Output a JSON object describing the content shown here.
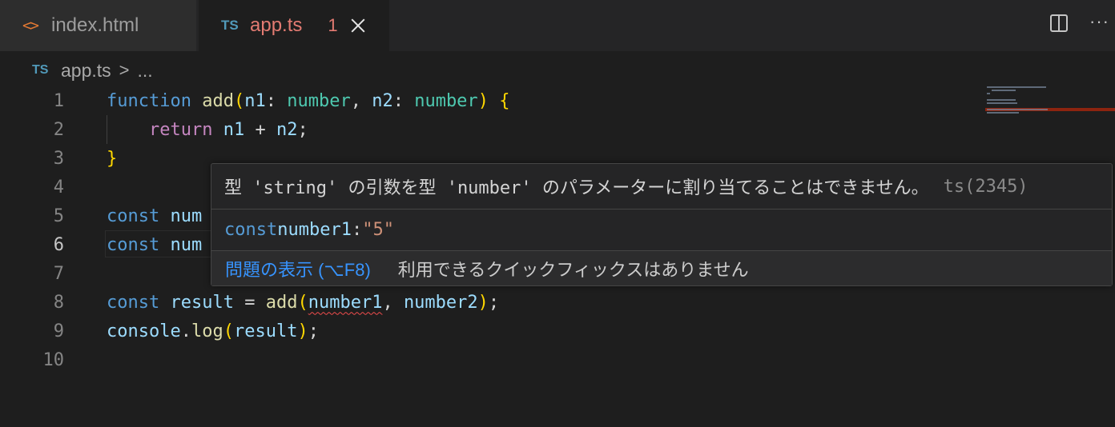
{
  "tabs": [
    {
      "icon": "html-icon",
      "label": "index.html"
    },
    {
      "icon": "ts-icon",
      "label": "app.ts",
      "problem_count": "1"
    }
  ],
  "icons": {
    "html_glyph": "<>",
    "ts_glyph": "TS",
    "more_glyph": "···"
  },
  "breadcrumb": {
    "file": "app.ts",
    "separator": ">",
    "rest": "..."
  },
  "editor": {
    "line_numbers": [
      "1",
      "2",
      "3",
      "4",
      "5",
      "6",
      "7",
      "8",
      "9",
      "10"
    ],
    "active_line": "6",
    "lines": {
      "l1": [
        {
          "t": "function",
          "c": "kw"
        },
        {
          "t": " ",
          "c": ""
        },
        {
          "t": "add",
          "c": "fn"
        },
        {
          "t": "(",
          "c": "br1"
        },
        {
          "t": "n1",
          "c": "var"
        },
        {
          "t": ": ",
          "c": ""
        },
        {
          "t": "number",
          "c": "typ"
        },
        {
          "t": ", ",
          "c": ""
        },
        {
          "t": "n2",
          "c": "var"
        },
        {
          "t": ": ",
          "c": ""
        },
        {
          "t": "number",
          "c": "typ"
        },
        {
          "t": ")",
          "c": "br1"
        },
        {
          "t": " ",
          "c": ""
        },
        {
          "t": "{",
          "c": "br1"
        }
      ],
      "l2": [
        {
          "t": "    ",
          "c": ""
        },
        {
          "t": "return",
          "c": "kw2"
        },
        {
          "t": " ",
          "c": ""
        },
        {
          "t": "n1",
          "c": "var"
        },
        {
          "t": " + ",
          "c": ""
        },
        {
          "t": "n2",
          "c": "var"
        },
        {
          "t": ";",
          "c": ""
        }
      ],
      "l3": [
        {
          "t": "}",
          "c": "br1"
        }
      ],
      "l5": [
        {
          "t": "const",
          "c": "kw"
        },
        {
          "t": " ",
          "c": ""
        },
        {
          "t": "num",
          "c": "var"
        }
      ],
      "l6": [
        {
          "t": "const",
          "c": "kw"
        },
        {
          "t": " ",
          "c": ""
        },
        {
          "t": "num",
          "c": "var"
        }
      ],
      "l8": [
        {
          "t": "const",
          "c": "kw"
        },
        {
          "t": " ",
          "c": ""
        },
        {
          "t": "result",
          "c": "var"
        },
        {
          "t": " = ",
          "c": ""
        },
        {
          "t": "add",
          "c": "fn"
        },
        {
          "t": "(",
          "c": "br1"
        },
        {
          "t": "number1",
          "c": "var sq"
        },
        {
          "t": ", ",
          "c": ""
        },
        {
          "t": "number2",
          "c": "var"
        },
        {
          "t": ")",
          "c": "br1"
        },
        {
          "t": ";",
          "c": ""
        }
      ],
      "l9": [
        {
          "t": "console",
          "c": "var"
        },
        {
          "t": ".",
          "c": ""
        },
        {
          "t": "log",
          "c": "fn"
        },
        {
          "t": "(",
          "c": "br1"
        },
        {
          "t": "result",
          "c": "var"
        },
        {
          "t": ")",
          "c": "br1"
        },
        {
          "t": ";",
          "c": ""
        }
      ]
    }
  },
  "hover": {
    "message": "型 'string' の引数を型 'number' のパラメーターに割り当てることはできません。",
    "error_code": "ts(2345)",
    "code_keyword": "const",
    "code_name": "number1",
    "code_colon": ":",
    "code_value": "\"5\"",
    "view_problem": "問題の表示 (⌥F8)",
    "no_fixes": "利用できるクイックフィックスはありません"
  },
  "colors": {
    "background": "#1e1e1e",
    "error": "#f14c4c",
    "link": "#3794ff"
  }
}
